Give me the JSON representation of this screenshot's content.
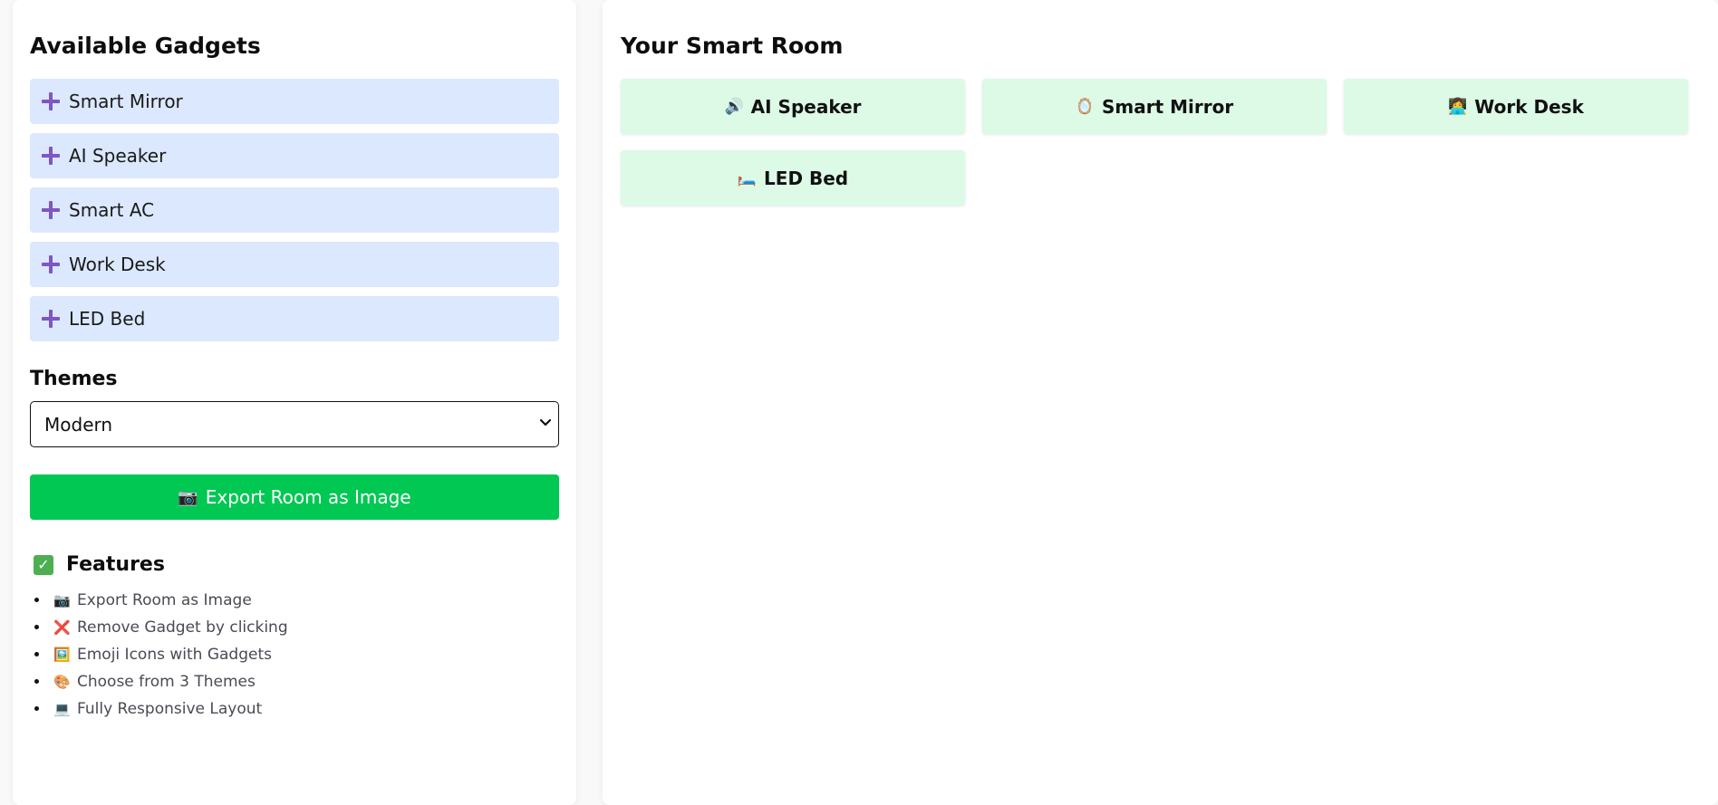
{
  "left": {
    "title": "Available Gadgets",
    "gadgets": [
      {
        "label": "Smart Mirror",
        "icon": "plus-icon"
      },
      {
        "label": "AI Speaker",
        "icon": "plus-icon"
      },
      {
        "label": "Smart AC",
        "icon": "plus-icon"
      },
      {
        "label": "Work Desk",
        "icon": "plus-icon"
      },
      {
        "label": "LED Bed",
        "icon": "plus-icon"
      }
    ],
    "themes_title": "Themes",
    "theme_select": {
      "value": "Modern"
    },
    "export_button": {
      "emoji": "📷",
      "label": "Export Room as Image"
    },
    "features": {
      "emoji": "✅",
      "title": "Features",
      "items": [
        {
          "emoji": "📷",
          "text": "Export Room as Image"
        },
        {
          "emoji": "❌",
          "text": "Remove Gadget by clicking"
        },
        {
          "emoji": "🖼️",
          "text": "Emoji Icons with Gadgets"
        },
        {
          "emoji": "🎨",
          "text": "Choose from 3 Themes"
        },
        {
          "emoji": "💻",
          "text": "Fully Responsive Layout"
        }
      ]
    }
  },
  "right": {
    "title": "Your Smart Room",
    "room_items": [
      {
        "emoji": "🔊",
        "label": "AI Speaker"
      },
      {
        "emoji": "🪞",
        "label": "Smart Mirror"
      },
      {
        "emoji": "👩‍💻",
        "label": "Work Desk"
      },
      {
        "emoji": "🛏️",
        "label": "LED Bed"
      }
    ]
  },
  "colors": {
    "gadget_bg": "#dbe8fd",
    "plus_icon": "#7e57c2",
    "export_button": "#00c853",
    "room_card_bg": "#dcfae6"
  }
}
